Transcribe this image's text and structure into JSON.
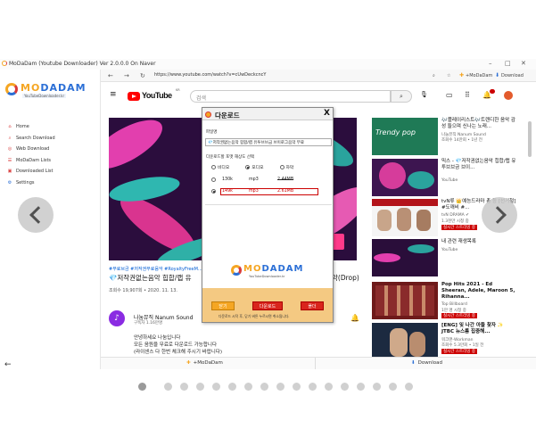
{
  "window": {
    "title": "MoDaDam (Youtube Downloader) Ver 2.0.0.0 On Naver",
    "controls": [
      "–",
      "□",
      "✕"
    ]
  },
  "app": {
    "logo_text_a": "MO",
    "logo_text_b": "DADAM",
    "logo_sub": "YouTubeDownloader.kr",
    "nav": [
      {
        "label": "Home",
        "icon": "home-icon"
      },
      {
        "label": "Search Download",
        "icon": "search-icon"
      },
      {
        "label": "Web Download",
        "icon": "globe-icon"
      },
      {
        "label": "MoDaDam Lists",
        "icon": "list-icon"
      },
      {
        "label": "Downloaded List",
        "icon": "folder-icon"
      },
      {
        "label": "Settings",
        "icon": "gear-icon"
      }
    ],
    "back_label": "←"
  },
  "browser": {
    "url": "https://www.youtube.com/watch?v=cUwDeckcncY",
    "ext_modadam": "+MoDaDam",
    "ext_download": "Download"
  },
  "youtube": {
    "logo_word": "YouTube",
    "region": "KR",
    "search_placeholder": "검색",
    "video_tags": "#무료브금 #저작권무료음악 #RoyaltyFreeM...",
    "video_title": "💎저작권없는음악 힙합/랩 유투브 브금 브이로그 음악(Drop)",
    "video_title_short": "💎저작권없는음악 힙합/랩 유",
    "video_title_tail": "악(Drop)",
    "video_meta": "조회수 19,907회 • 2020. 11. 13.",
    "channel_name": "나눔뮤직 Nanum Sound",
    "channel_subs": "구독자 1.16만명",
    "desc_lines": [
      "안녕하세요 나눔입니다",
      "모든 음원을 무료로 다운로드 가능합니다",
      "(라이센스 다 한번 체크해 주시기 바랍니다)"
    ],
    "recommendations": [
      {
        "title": "🎶플레이리스트🎶트렌디한 음악 감성 들으며 신나는 노래...",
        "channel": "나눔뮤직 Nanum Sound",
        "meta": "조회수 14만회 • 1년 전",
        "badge": ""
      },
      {
        "title": "믹스 - 💎저작권없는음악 힙합/랩 유투브브금 브이...",
        "channel": "YouTube",
        "meta": "",
        "badge": ""
      },
      {
        "title": "tvN류 👑예능드라마 총 등 [선거철] #도깨비 #...",
        "channel": "tvN DRAMA ✔",
        "meta": "1.3천만 시청 중",
        "badge": "실시간 스트리밍 중"
      },
      {
        "title": "내 관련 재생목록",
        "channel": "YouTube",
        "meta": "",
        "badge": ""
      },
      {
        "title": "Pop Hits 2021 - Ed Sheeran, Adele, Maroon 5, Rihanna...",
        "channel": "Top Billboard",
        "meta": "1만 명 시청 중",
        "badge": "실시간 스트리밍 중"
      },
      {
        "title": "[ENG] 잊 나간 아들 찾자 ✨ JTBC 뉴스룸 집중해...",
        "channel": "워크맨-Workman",
        "meta": "조회수 5.3만회 • 1일 전",
        "badge": "실시간 스트리밍 중"
      }
    ]
  },
  "dialog": {
    "title": "다운로드",
    "close": "X",
    "file_label": "파일명",
    "file_name": "💎저작권없는음악 힙합/랩 유투브브금 브이로그음악 무료",
    "quality_label": "다운로드할 포맷 해상도 선택",
    "types": [
      {
        "label": "비디오",
        "selected": false
      },
      {
        "label": "오디오",
        "selected": true
      },
      {
        "label": "자막",
        "selected": false
      }
    ],
    "formats": [
      {
        "bitrate": "130k",
        "ext": "mp3",
        "size": "2.44MB",
        "selected": false
      },
      {
        "bitrate": "149k",
        "ext": "mp3",
        "size": "2.61MB",
        "selected": true
      }
    ],
    "buttons": {
      "close": "닫기",
      "download": "다운로드",
      "folder": "폴더"
    },
    "note": "다운로드 시작 후, 닫기 버튼 누르시면 취소됩니다.",
    "logo_a": "MO",
    "logo_b": "DADAM",
    "logo_sub": "YouTubeDownloader.kr"
  },
  "bottom_bar": {
    "left": "+MoDaDam",
    "right": "Download"
  },
  "carousel": {
    "dots": 17,
    "active": 0
  },
  "colors": {
    "brand_orange": "#f5a623",
    "brand_blue": "#2b6fd6",
    "youtube_red": "#ff0000",
    "dialog_bar": "#f4c982"
  }
}
